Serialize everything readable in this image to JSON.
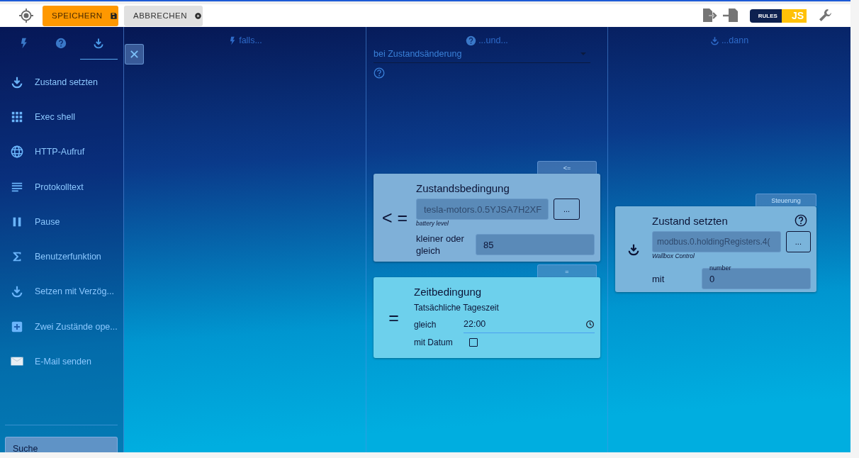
{
  "toolbar": {
    "buttons": [
      {
        "label": "SPEICHERN",
        "kind": "primary"
      },
      {
        "label": "ABBRECHEN",
        "kind": "secondary"
      }
    ],
    "logo": {
      "left": "RULES",
      "right": "JS"
    }
  },
  "sidebar": {
    "tabs": [
      {
        "kind": "flash",
        "selected": false
      },
      {
        "kind": "help",
        "selected": false
      },
      {
        "kind": "download",
        "selected": true
      }
    ],
    "items": [
      {
        "kind": "download",
        "label": "Zustand setzten"
      },
      {
        "kind": "grid",
        "label": "Exec shell"
      },
      {
        "kind": "globe",
        "label": "HTTP-Aufruf"
      },
      {
        "kind": "lines",
        "label": "Protokolltext"
      },
      {
        "kind": "pause",
        "label": "Pause"
      },
      {
        "kind": "sigma",
        "label": "Benutzerfunktion"
      },
      {
        "kind": "download",
        "label": "Setzen mit Verzög..."
      },
      {
        "kind": "plus",
        "label": "Zwei Zustände ope..."
      },
      {
        "kind": "mail",
        "label": "E-Mail senden"
      }
    ],
    "search": {
      "placeholder": "Suche"
    }
  },
  "columns": [
    {
      "kind": "flash",
      "title": "falls..."
    },
    {
      "kind": "help",
      "title": "...und...",
      "select": "bei Zustandsänderung",
      "blocks": [
        {
          "kind": "state_condition",
          "tab": "<=",
          "symbol": "< =",
          "title": "Zustandsbedingung",
          "object_id": "tesla-motors.0.5YJSA7H2XF",
          "object_name": "battery level",
          "browse": "...",
          "label": "kleiner oder gleich",
          "value": "85"
        },
        {
          "kind": "time_condition",
          "tab": "=",
          "symbol": "=",
          "title": "Zeitbedingung",
          "subtitle": "Tatsächliche Tageszeit",
          "label": "gleich",
          "value": "22:00",
          "date_label": "mit Datum",
          "date_checked": false
        }
      ]
    },
    {
      "kind": "download",
      "title": "...dann",
      "blocks": [
        {
          "kind": "set_state",
          "tab": "Steuerung",
          "title": "Zustand setzten",
          "object_id": "modbus.0.holdingRegisters.4(",
          "object_name": "Wallbox Control",
          "browse": "...",
          "label": "mit",
          "value_label": "number",
          "value": "0"
        }
      ]
    }
  ]
}
